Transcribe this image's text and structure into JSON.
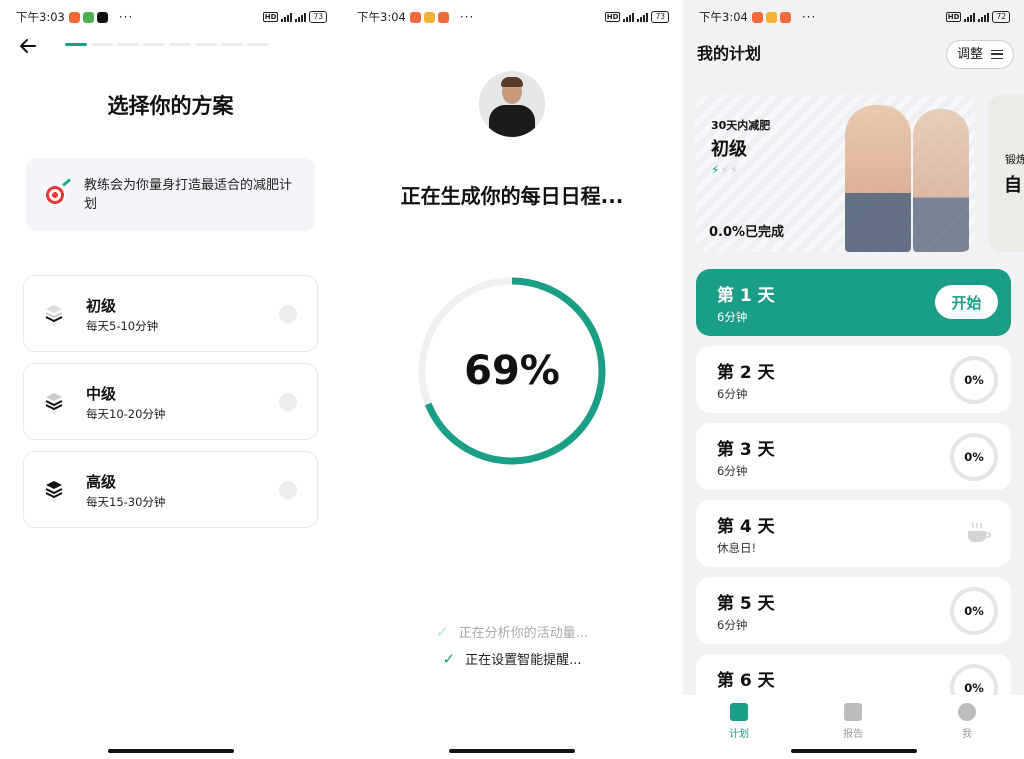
{
  "colors": {
    "accent": "#1a9e85",
    "track": "#f0f0f0",
    "card_bg": "#ffffff"
  },
  "screen1": {
    "status": {
      "time": "下午3:03",
      "battery": "73"
    },
    "back_icon": "arrow-left-icon",
    "progress_step": 1,
    "progress_total": 8,
    "title": "选择你的方案",
    "tip": {
      "icon": "target-icon",
      "text": "教练会为你量身打造最适合的减肥计划"
    },
    "levels": [
      {
        "name": "初级",
        "desc": "每天5-10分钟",
        "icon": "layers-light-icon",
        "selected": false
      },
      {
        "name": "中级",
        "desc": "每天10-20分钟",
        "icon": "layers-medium-icon",
        "selected": false
      },
      {
        "name": "高级",
        "desc": "每天15-30分钟",
        "icon": "layers-dark-icon",
        "selected": false
      }
    ]
  },
  "screen2": {
    "status": {
      "time": "下午3:04",
      "battery": "73"
    },
    "title": "正在生成你的每日日程...",
    "progress_value": 69,
    "progress_text": "69%",
    "steps": [
      {
        "text": "正在分析你的活动量...",
        "state": "faded"
      },
      {
        "text": "正在设置智能提醒...",
        "state": "active"
      }
    ]
  },
  "screen3": {
    "status": {
      "time": "下午3:04",
      "battery": "72"
    },
    "header": "我的计划",
    "adjust_label": "调整",
    "plan_card": {
      "subtitle": "30天内减肥",
      "level": "初级",
      "bolts_on": 1,
      "bolts_total": 3,
      "done": "0.0%已完成"
    },
    "plan_card2": {
      "subtitle": "锻炼",
      "level": "自"
    },
    "days": [
      {
        "name": "第 1 天",
        "sub": "6分钟",
        "type": "start",
        "action": "开始"
      },
      {
        "name": "第 2 天",
        "sub": "6分钟",
        "type": "progress",
        "pct": "0%"
      },
      {
        "name": "第 3 天",
        "sub": "6分钟",
        "type": "progress",
        "pct": "0%"
      },
      {
        "name": "第 4 天",
        "sub": "休息日!",
        "type": "rest",
        "icon": "coffee-cup-icon"
      },
      {
        "name": "第 5 天",
        "sub": "6分钟",
        "type": "progress",
        "pct": "0%"
      },
      {
        "name": "第 6 天",
        "sub": "",
        "type": "progress",
        "pct": "0%"
      }
    ],
    "tabs": [
      {
        "label": "计划",
        "icon": "plan-icon",
        "active": true
      },
      {
        "label": "报告",
        "icon": "calendar-icon",
        "active": false
      },
      {
        "label": "我",
        "icon": "person-icon",
        "active": false
      }
    ]
  }
}
